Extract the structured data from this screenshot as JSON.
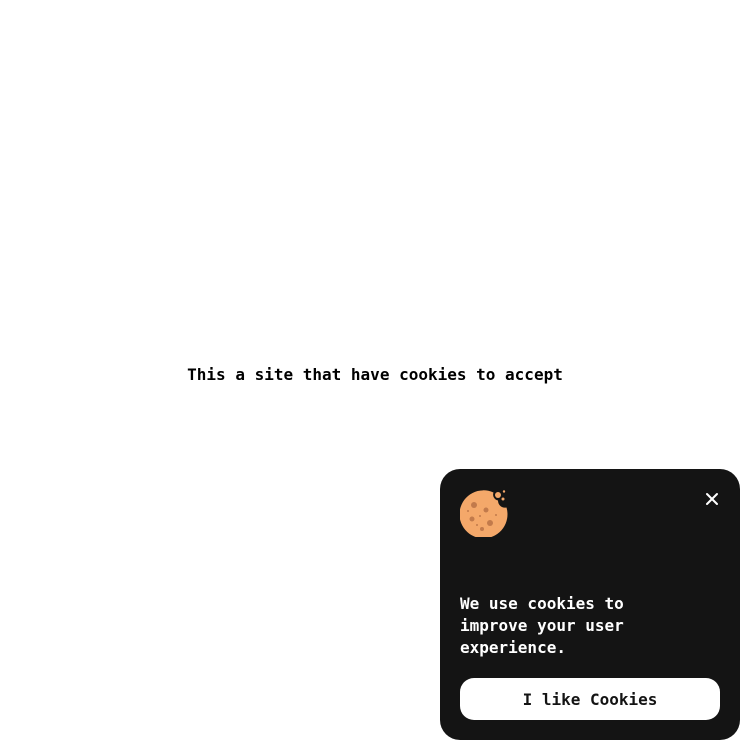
{
  "page": {
    "main_text": "This a site that have cookies to accept"
  },
  "cookie_banner": {
    "icon": "cookie-icon",
    "close_icon": "close-icon",
    "message": "We use cookies to improve your user experience.",
    "accept_label": "I like Cookies",
    "colors": {
      "background": "#141414",
      "text": "#ffffff",
      "button_bg": "#ffffff",
      "button_text": "#141414",
      "cookie": "#f4a86a",
      "chip": "#c27a4b"
    }
  }
}
